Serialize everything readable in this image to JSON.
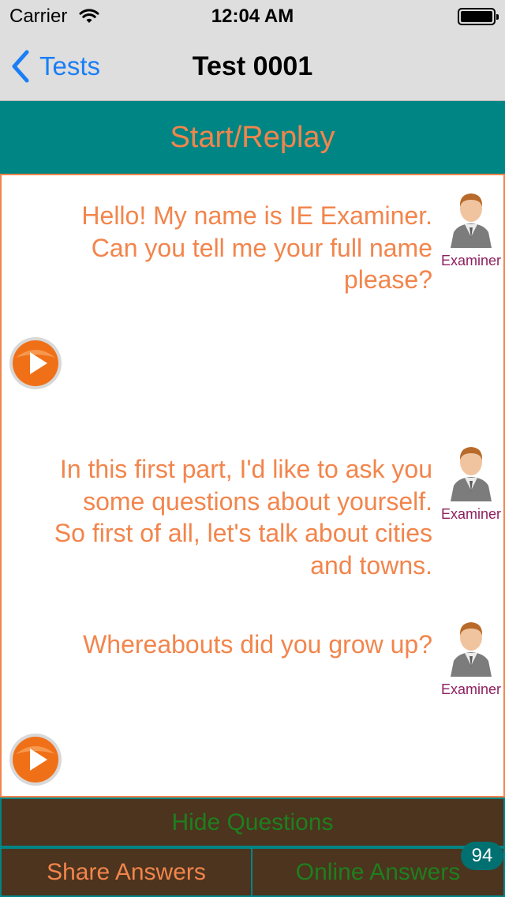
{
  "status_bar": {
    "carrier": "Carrier",
    "time": "12:04 AM"
  },
  "nav": {
    "back_label": "Tests",
    "title": "Test 0001"
  },
  "start_replay_label": "Start/Replay",
  "messages": [
    {
      "text": "Hello! My name is IE Examiner. Can you tell me your full name please?",
      "speaker": "Examiner"
    },
    {
      "text": "In this first part, I'd like to ask you some questions about yourself. So first of all, let's talk about cities and towns.",
      "speaker": "Examiner"
    },
    {
      "text": "Whereabouts did you grow up?",
      "speaker": "Examiner"
    }
  ],
  "bottom": {
    "hide_questions": "Hide Questions",
    "share_answers": "Share Answers",
    "online_answers": "Online Answers",
    "online_badge": "94"
  },
  "colors": {
    "accent_orange": "#f2854c",
    "teal": "#008585",
    "bottom_brown": "#4c341e",
    "green_text": "#1e7f1e",
    "ios_blue": "#1a7ef5",
    "speaker_label": "#8e1f5e"
  },
  "icons": {
    "back": "chevron-left-icon",
    "wifi": "wifi-icon",
    "battery": "battery-icon",
    "avatar": "examiner-avatar-icon",
    "play": "play-icon"
  }
}
